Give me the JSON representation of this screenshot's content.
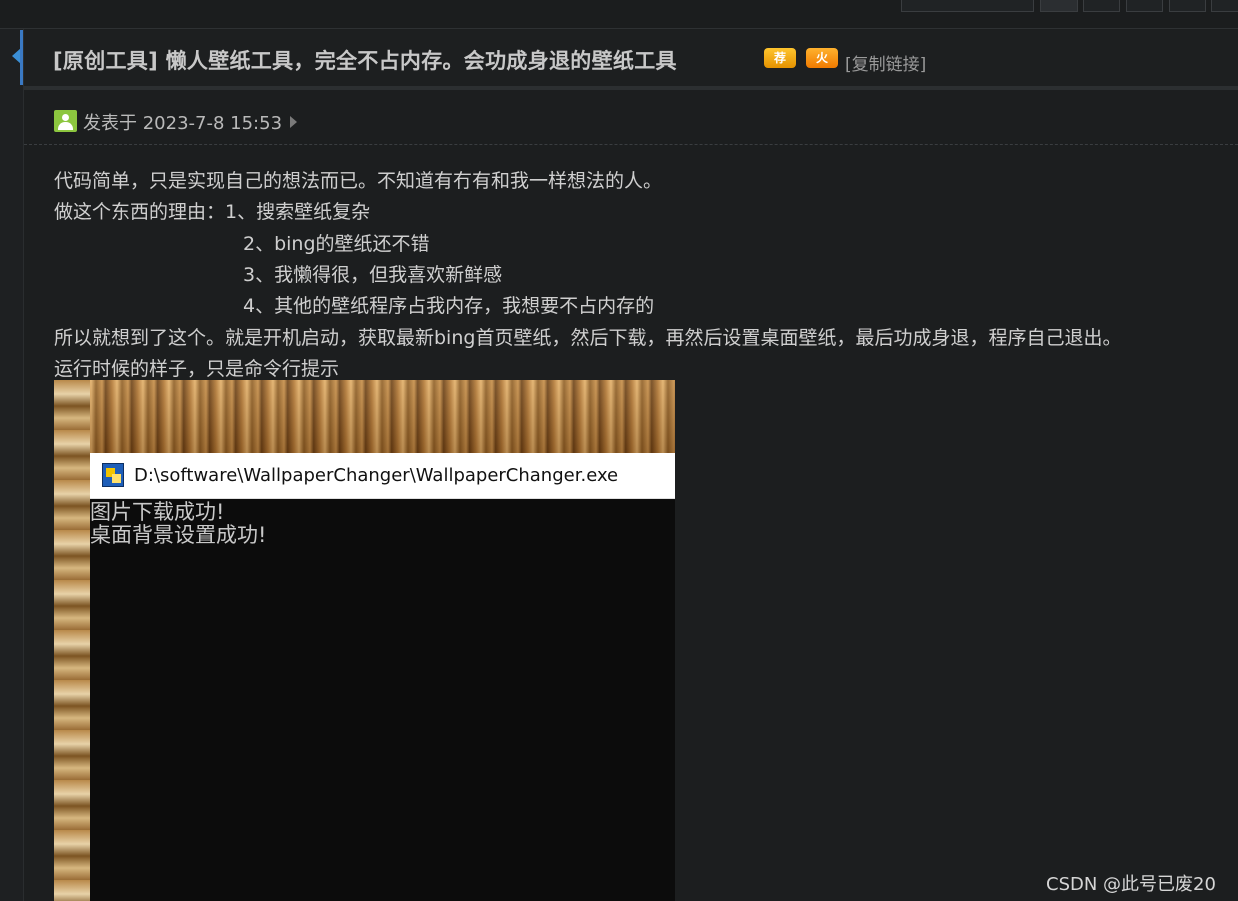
{
  "thread": {
    "title": "[原创工具] 懒人壁纸工具，完全不占内存。会功成身退的壁纸工具",
    "badges": [
      {
        "icon": "recommend-badge-icon",
        "label": "荐"
      },
      {
        "icon": "hot-badge-icon",
        "label": "火"
      }
    ],
    "copy_link_label": "[复制链接]"
  },
  "post": {
    "date_text": "发表于 2023-7-8 15:53",
    "lines": [
      "代码简单，只是实现自己的想法而已。不知道有冇有和我一样想法的人。",
      "做这个东西的理由：1、搜索壁纸复杂",
      "2、bing的壁纸还不错",
      "3、我懒得很，但我喜欢新鲜感",
      "4、其他的壁纸程序占我内存，我想要不占内存的",
      "所以就想到了这个。就是开机启动，获取最新bing首页壁纸，然后下载，再然后设置桌面壁纸，最后功成身退，程序自己退出。",
      "运行时候的样子，只是命令行提示"
    ]
  },
  "console": {
    "title": "D:\\software\\WallpaperChanger\\WallpaperChanger.exe",
    "output": [
      "图片下载成功!",
      "桌面背景设置成功!"
    ]
  },
  "watermark": "CSDN @此号已废20",
  "colors": {
    "background": "#1c1e1f",
    "accent": "#3a79c4",
    "avatar": "#8cc63f",
    "badge_rec": "#f5b21a",
    "badge_hot": "#f5890f"
  }
}
